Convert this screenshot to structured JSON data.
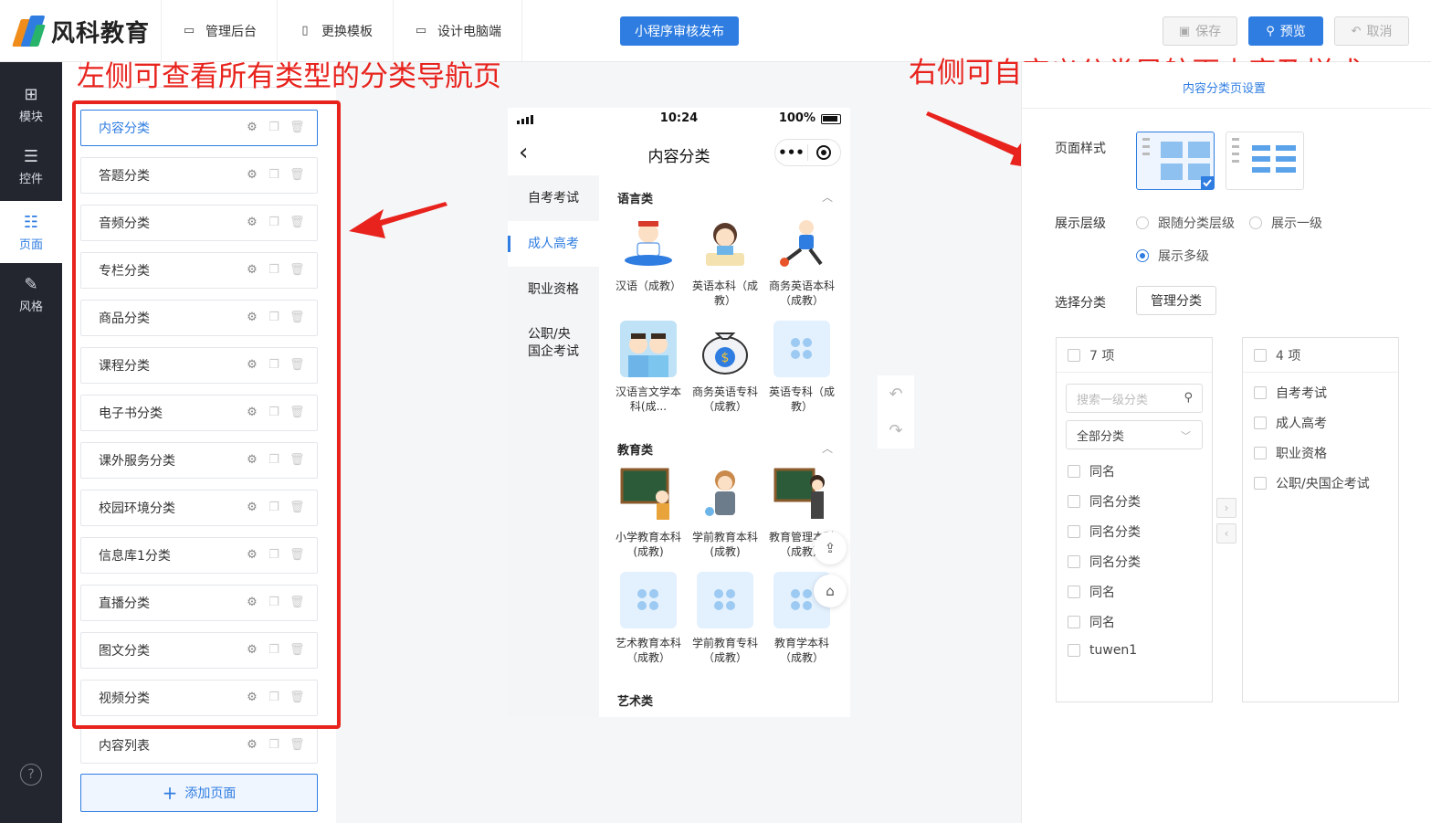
{
  "brand": {
    "name": "风科教育"
  },
  "topnav": [
    {
      "label": "管理后台",
      "icon": "dashboard-icon"
    },
    {
      "label": "更换模板",
      "icon": "template-icon"
    },
    {
      "label": "设计电脑端",
      "icon": "monitor-icon"
    }
  ],
  "toolbar": {
    "publish": "小程序审核发布",
    "save": "保存",
    "preview": "预览",
    "cancel": "取消"
  },
  "sidebar": [
    {
      "label": "模块",
      "icon": "plus-square-icon"
    },
    {
      "label": "控件",
      "icon": "sliders-icon"
    },
    {
      "label": "页面",
      "icon": "pages-icon",
      "active": true
    },
    {
      "label": "风格",
      "icon": "brush-icon"
    }
  ],
  "pages": {
    "items": [
      "内容分类",
      "答题分类",
      "音频分类",
      "专栏分类",
      "商品分类",
      "课程分类",
      "电子书分类",
      "课外服务分类",
      "校园环境分类",
      "信息库1分类",
      "直播分类",
      "图文分类",
      "视频分类",
      "内容列表"
    ],
    "active_index": 0,
    "add_label": "添加页面"
  },
  "annotations": {
    "left": "左侧可查看所有类型的分类导航页",
    "right": "右侧可自定义分类导航页内容及样式"
  },
  "phone": {
    "time": "10:24",
    "battery": "100%",
    "title": "内容分类",
    "menu_dots": "•••",
    "categories": [
      "自考考试",
      "成人高考",
      "职业资格",
      "公职/央国企考试"
    ],
    "selected_category": 1,
    "sections": [
      {
        "title": "语言类",
        "items": [
          "汉语（成教）",
          "英语本科（成教）",
          "商务英语本科（成教）",
          "汉语言文学本科(成...",
          "商务英语专科（成教）",
          "英语专科（成教）"
        ]
      },
      {
        "title": "教育类",
        "items": [
          "小学教育本科(成教)",
          "学前教育本科(成教)",
          "教育管理本科（成教）",
          "艺术教育本科（成教）",
          "学前教育专科（成教）",
          "教育学本科（成教）"
        ]
      },
      {
        "title": "艺术类",
        "items": []
      }
    ]
  },
  "settings": {
    "tab": "内容分类页设置",
    "page_style_label": "页面样式",
    "level_label": "展示层级",
    "level_options": [
      "跟随分类层级",
      "展示一级",
      "展示多级"
    ],
    "level_selected": 2,
    "select_label": "选择分类",
    "manage_btn": "管理分类",
    "left_count": "7 项",
    "search_placeholder": "搜索一级分类",
    "filter_value": "全部分类",
    "left_items": [
      "同名",
      "同名分类",
      "同名分类",
      "同名分类",
      "同名",
      "同名",
      "tuwen1"
    ],
    "right_count": "4 项",
    "right_items": [
      "自考考试",
      "成人高考",
      "职业资格",
      "公职/央国企考试"
    ]
  },
  "colors": {
    "accent": "#2f7de1",
    "annotation": "#e8231d",
    "sidebar": "#23262e"
  }
}
